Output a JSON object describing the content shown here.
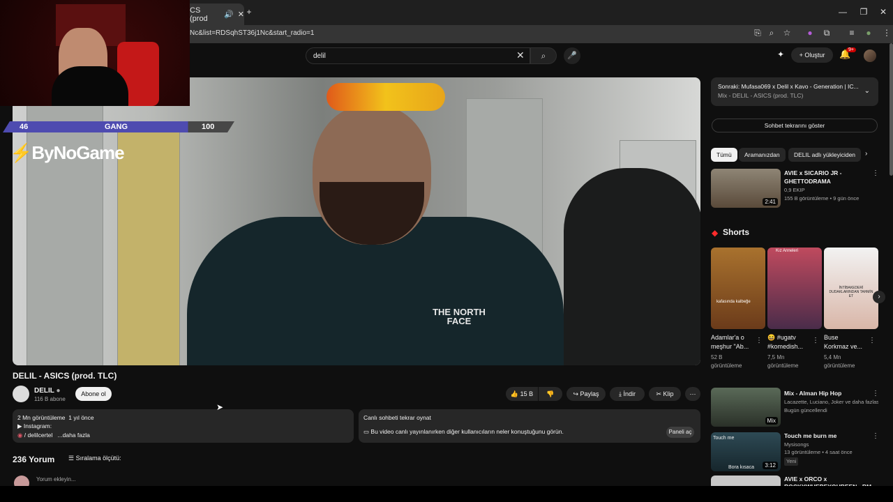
{
  "browser": {
    "tab_title": "CS (prod",
    "url": "Nc&list=RDSqhST36j1Nc&start_radio=1"
  },
  "header": {
    "search_value": "delil",
    "create_label": "Oluştur",
    "notif_badge": "9+"
  },
  "overlay": {
    "gang_left": "46",
    "gang_center": "GANG",
    "gang_right": "100",
    "logo_text": "ByNoGame",
    "shirt_text": "THE NORTH FACE"
  },
  "video": {
    "title": "DELIL - ASICS (prod. TLC)",
    "channel": "DELIL",
    "subscribers": "116 B abone",
    "subscribe_label": "Abone ol",
    "likes": "15 B",
    "share_label": "Paylaş",
    "download_label": "İndir",
    "clip_label": "Klip"
  },
  "description": {
    "views": "2 Mn görüntüleme",
    "date": "1 yıl önce",
    "line2": "▶ Instagram:",
    "handle": "/ delilcertel",
    "more": "...daha fazla"
  },
  "chat_replay": {
    "title": "Canlı sohbeti tekrar oynat",
    "text": "Bu video canlı yayınlanırken diğer kullanıcıların neler konuştuğunu görün.",
    "button": "Paneli aç"
  },
  "comments": {
    "count": "236 Yorum",
    "sort": "Sıralama ölçütü:",
    "placeholder": "Yorum ekleyin..."
  },
  "sidebar": {
    "next_title": "Sonraki: Mufasa069 x Delil x Kavo - Generation | IC...",
    "next_sub": "Mix - DELIL - ASICS (prod. TLC)",
    "chat_replay_btn": "Sohbet tekrarını göster",
    "chips": [
      "Tümü",
      "Aramanızdan",
      "DELIL adlı yükleyiciden"
    ],
    "rec1": {
      "title1": "AVIE x SICARIO JR -",
      "title2": "GHETTODRAMA",
      "channel": "0,9 EKIP",
      "meta": "155 B görüntüleme • 9 gün önce",
      "duration": "2:41"
    },
    "shorts_title": "Shorts",
    "shorts": [
      {
        "t1": "Adamlar'a o",
        "t2": "meşhur \"Ab...",
        "views": "52 B",
        "label": "görüntüleme",
        "caption": "kafasında kalbeğe"
      },
      {
        "t1": "😆 #ugatv",
        "t2": "#komedish...",
        "views": "7,5 Mn",
        "label": "görüntüleme",
        "caption": "Kız Anneleri"
      },
      {
        "t1": "Buse",
        "t2": "Korkmaz ve...",
        "views": "5,4 Mn",
        "label": "görüntüleme",
        "caption": "İNTİBAKEDERİ DUDAKLARINDAN TAHMİN ET"
      }
    ],
    "rec2": {
      "title": "Mix - Alman Hip Hop",
      "channel": "Lacazette, Luciano, Joker ve daha fazlası",
      "meta": "Bugün güncellendi",
      "badge": "Mix"
    },
    "rec3": {
      "title": "Touch me burn me",
      "channel": "Mysisongs",
      "meta": "13 görüntüleme • 4 saat önce",
      "tag": "Yeni",
      "duration": "3:12",
      "thumb_top": "Touch me",
      "thumb_bottom": "Bora kısaca"
    },
    "rec4": {
      "title1": "AVIE x ORCO x",
      "title2": "ROCKYWHEREYOUBEEN - BM"
    }
  }
}
